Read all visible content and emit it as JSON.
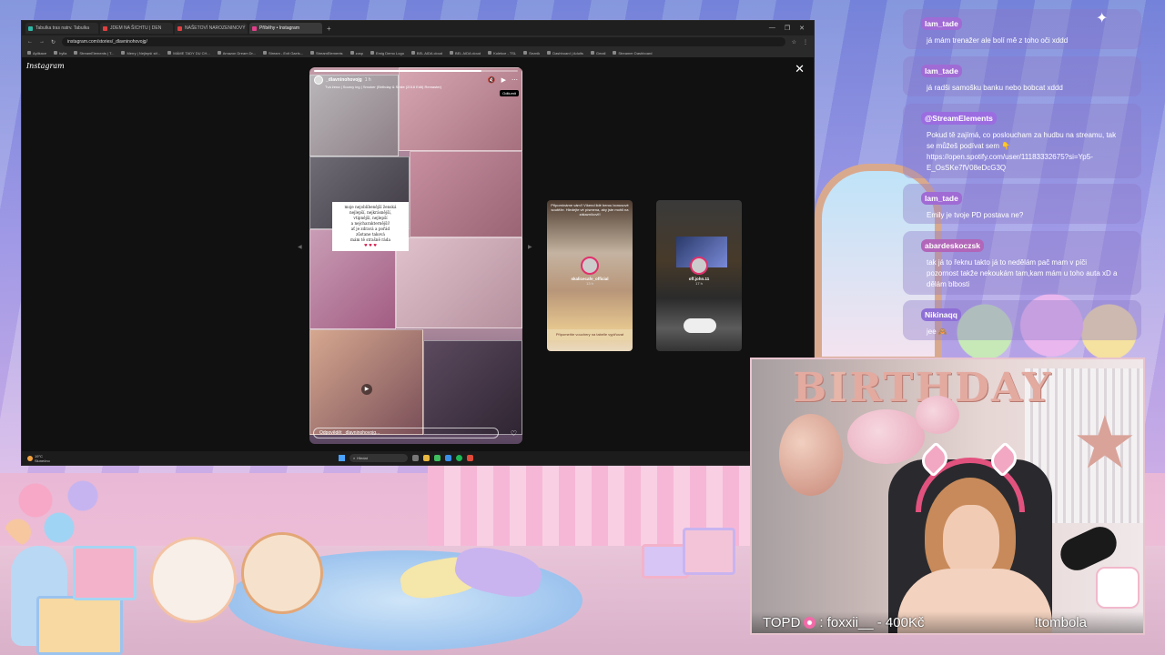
{
  "browser": {
    "tabs": [
      {
        "label": "Tabulka tras natrv. Tabulka",
        "active": false
      },
      {
        "label": "JDEM NA ŠICHTU | DEN",
        "active": false
      },
      {
        "label": "NAŠETOVÍ NAROZENINOVÝ",
        "active": false
      },
      {
        "label": "Příběhy • Instagram",
        "active": true
      }
    ],
    "new_tab": "+",
    "window_controls": [
      "—",
      "❐",
      "✕"
    ],
    "url": "instagram.com/stories/_dlavninohovojg/",
    "bookmarks": [
      "Aplikace",
      "hylla",
      "StreamElements | T...",
      "Merry | Nejlepší stř...",
      "MÁME TADY DU CH...",
      "Amazon Dream Dr...",
      "Stream - Exit Gaels...",
      "StreamElements",
      "zosp",
      "Emig Demo Logo",
      "BEL AIDA cloud",
      "BEL AIDA cloud",
      "Kolekce - TSL",
      "Seznik",
      "Dashboard | Adults",
      "Gmail",
      "Streamer Dashboard"
    ]
  },
  "instagram": {
    "logo": "Instagram",
    "close": "✕",
    "story": {
      "username": "_dlavninohovojg",
      "time": "1 h",
      "song": "Tvá žena | Sourcy ing | Smoker (Birthday & Smile (2018 Edit) Remaster)",
      "tooltip": "Odtlumit",
      "note_lines": [
        "moje nejoblíbenější ženská",
        "nejlepší, nejkrásnější,",
        "vtipnější, nejlepší",
        "a nejcharakternější!",
        "ať je zdravá a pořád",
        "zůstane taková",
        "mám tě strašně ráda"
      ],
      "note_hearts": "♥ ♥ ♥",
      "reply_placeholder": "Odpovědět _dlavninohovojg...",
      "progress": 0.82
    },
    "next_stories": [
      {
        "username": "skalicecafe_official",
        "age": "13 h",
        "top_text": "Připomínáme vám!! Víkend lidé berou bonusové soutěže. Hledejte vé písmena, aby jste mohli na zákazníkovi!!",
        "banner": "Připomeňte vouchery na tabelle vyplňovat"
      },
      {
        "username": "off.john.11",
        "age": "17 h",
        "top_text": "",
        "banner": ""
      }
    ]
  },
  "taskbar": {
    "weather_temp": "19°C",
    "weather_desc": "Slunečno",
    "search_placeholder": "Hledat"
  },
  "chat": {
    "messages": [
      {
        "user": "Iam_tade",
        "text": "já mám trenažer ale bolí mě z toho oči xddd",
        "color": "#a06bd4"
      },
      {
        "user": "Iam_tade",
        "text": "já radši samošku banku nebo bobcat xddd",
        "color": "#a06bd4"
      },
      {
        "user": "@StreamElements",
        "text": "Pokud tě zajímá, co posloucham za hudbu na streamu, tak se můžeš podívat sem 👇 https://open.spotify.com/user/11183332675?si=Yp5-E_OsSKe7fV08eDcG3Q",
        "color": "#9b6de0"
      },
      {
        "user": "Iam_tade",
        "text": "Emily je tvoje PD postava ne?",
        "color": "#a06bd4"
      },
      {
        "user": "abardeskoczsk",
        "text": "tak já to řeknu takto já to nedělám pač mam v píči pozornost takže nekoukám tam,kam mám u toho auta xD a dělám blbosti",
        "color": "#b266b9"
      },
      {
        "user": "Nikinaqq",
        "text": "jee 🙈",
        "color": "#8e6fd6"
      }
    ]
  },
  "overlay": {
    "topd_prefix": "TOPD",
    "topd_text": ": foxxii__ - 400Kč",
    "tombola": "!tombola"
  },
  "colors": {
    "chat_bubble": "#8c78c8",
    "streamelements": "#9b6de0",
    "accent_pink": "#e2527f"
  }
}
